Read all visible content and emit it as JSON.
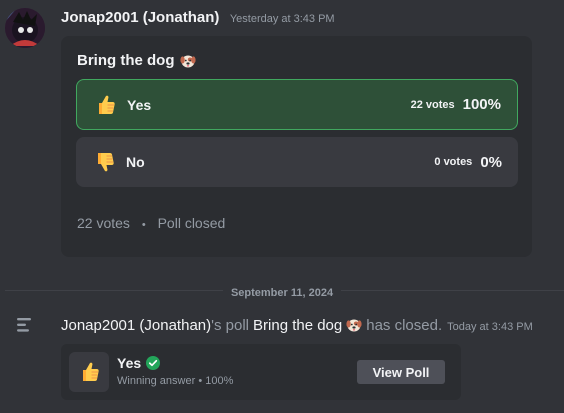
{
  "message": {
    "author": "Jonap2001 (Jonathan)",
    "timestamp": "Yesterday at 3:43 PM"
  },
  "poll": {
    "question": "Bring the dog",
    "question_emoji": "dog-face-icon",
    "answers": [
      {
        "label": "Yes",
        "emoji": "thumbs-up-icon",
        "votes": "22 votes",
        "percent": "100%",
        "winner": true
      },
      {
        "label": "No",
        "emoji": "thumbs-down-icon",
        "votes": "0 votes",
        "percent": "0%",
        "winner": false
      }
    ],
    "total_votes": "22 votes",
    "separator": "•",
    "status": "Poll closed"
  },
  "divider": {
    "date": "September 11, 2024"
  },
  "system_message": {
    "icon": "poll-result-icon",
    "author": "Jonap2001 (Jonathan)",
    "possessive": "'s poll",
    "poll_name": "Bring the dog",
    "suffix": "has closed.",
    "timestamp": "Today at 3:43 PM"
  },
  "result": {
    "winner_label": "Yes",
    "subtitle": "Winning answer • 100%",
    "button_label": "View Poll"
  },
  "colors": {
    "background": "#313338",
    "card": "#2b2d31",
    "winner_bg": "#2e5038",
    "winner_border": "#41a85f",
    "check_green": "#23a55a"
  }
}
